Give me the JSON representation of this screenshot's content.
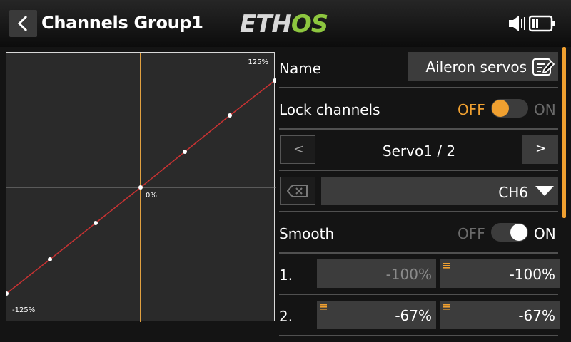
{
  "header": {
    "title": "Channels Group1",
    "logo_part1": "ETH",
    "logo_part2": "OS"
  },
  "graph": {
    "label_top_right": "125%",
    "label_center": "0%",
    "label_bottom_left": "-125%"
  },
  "form": {
    "name_label": "Name",
    "name_value": "Aileron servos",
    "lock_label": "Lock channels",
    "lock_off": "OFF",
    "lock_on": "ON",
    "servo_prev": "<",
    "servo_value": "Servo1 / 2",
    "servo_next": ">",
    "channel_value": "CH6",
    "smooth_label": "Smooth",
    "smooth_off": "OFF",
    "smooth_on": "ON",
    "points": [
      {
        "index": "1.",
        "left": "-100%",
        "right": "-100%"
      },
      {
        "index": "2.",
        "left": "-67%",
        "right": "-67%"
      }
    ]
  },
  "colors": {
    "accent": "#f0a030",
    "curve": "#c83232",
    "logo_green": "#8dc63f"
  }
}
